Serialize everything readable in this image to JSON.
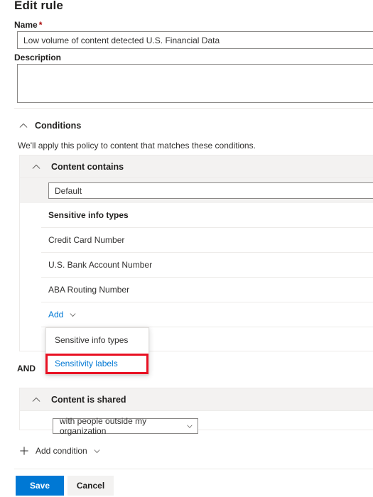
{
  "page": {
    "title": "Edit rule"
  },
  "form": {
    "name_label": "Name",
    "name_required_mark": "*",
    "name_value": "Low volume of content detected U.S. Financial Data",
    "name_placeholder": "",
    "description_label": "Description",
    "description_value": "",
    "description_placeholder": ""
  },
  "conditions": {
    "section_label": "Conditions",
    "helper_text": "We'll apply this policy to content that matches these conditions.",
    "and_label": "AND",
    "add_condition_label": "Add condition",
    "groups": [
      {
        "title": "Content contains",
        "picker_value": "Default",
        "table_header": "Sensitive info types",
        "items": [
          "Credit Card Number",
          "U.S. Bank Account Number",
          "ABA Routing Number"
        ],
        "add_label": "Add"
      },
      {
        "title": "Content is shared",
        "combo_value": "with people outside my organization"
      }
    ]
  },
  "add_menu": {
    "items": [
      {
        "label": "Sensitive info types",
        "highlighted": false
      },
      {
        "label": "Sensitivity labels",
        "highlighted": true
      }
    ]
  },
  "footer": {
    "save_label": "Save",
    "cancel_label": "Cancel"
  },
  "colors": {
    "accent": "#0078d4",
    "highlight_box": "#e81123",
    "required_star": "#a80000",
    "band_background": "#f3f2f1",
    "border": "#edebe9"
  }
}
